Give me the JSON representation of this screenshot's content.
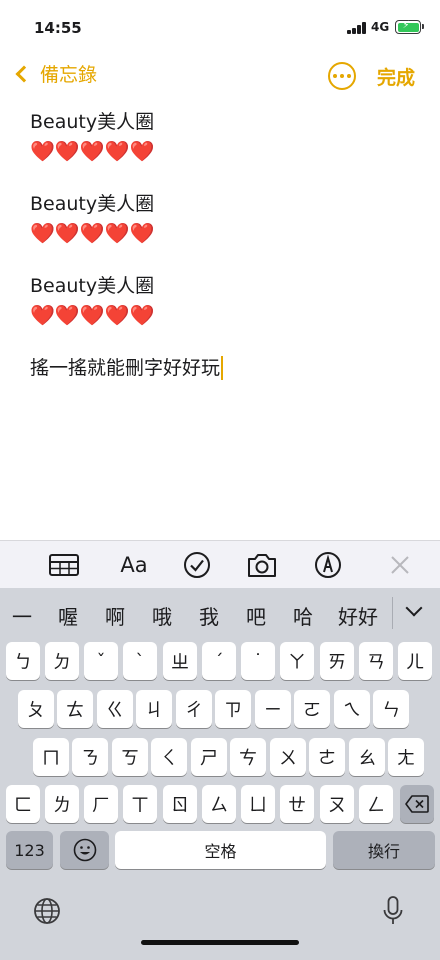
{
  "status": {
    "time": "14:55",
    "network": "4G"
  },
  "nav": {
    "back_label": "備忘錄",
    "done_label": "完成"
  },
  "note": {
    "blocks": [
      {
        "title": "Beauty美人圈",
        "hearts": "❤️❤️❤️❤️❤️"
      },
      {
        "title": "Beauty美人圈",
        "hearts": "❤️❤️❤️❤️❤️"
      },
      {
        "title": "Beauty美人圈",
        "hearts": "❤️❤️❤️❤️❤️"
      }
    ],
    "typed_text": "搖一搖就能刪字好好玩"
  },
  "toolbar": {
    "format_label": "Aa"
  },
  "keyboard": {
    "candidates": [
      "一",
      "喔",
      "啊",
      "哦",
      "我",
      "吧",
      "哈",
      "好好"
    ],
    "row1": [
      "ㄅ",
      "ㄉ",
      "ˇ",
      "ˋ",
      "ㄓ",
      "ˊ",
      "˙",
      "ㄚ",
      "ㄞ",
      "ㄢ",
      "ㄦ"
    ],
    "row2": [
      "ㄆ",
      "ㄊ",
      "ㄍ",
      "ㄐ",
      "ㄔ",
      "ㄗ",
      "ㄧ",
      "ㄛ",
      "ㄟ",
      "ㄣ"
    ],
    "row3": [
      "ㄇ",
      "ㄋ",
      "ㄎ",
      "ㄑ",
      "ㄕ",
      "ㄘ",
      "ㄨ",
      "ㄜ",
      "ㄠ",
      "ㄤ"
    ],
    "row4": [
      "ㄈ",
      "ㄌ",
      "ㄏ",
      "ㄒ",
      "ㄖ",
      "ㄙ",
      "ㄩ",
      "ㄝ",
      "ㄡ",
      "ㄥ"
    ],
    "numbers_label": "123",
    "space_label": "空格",
    "return_label": "換行"
  },
  "colors": {
    "accent": "#e5a700",
    "heart": "#e8242f",
    "keyboard_bg": "#d1d4da"
  }
}
